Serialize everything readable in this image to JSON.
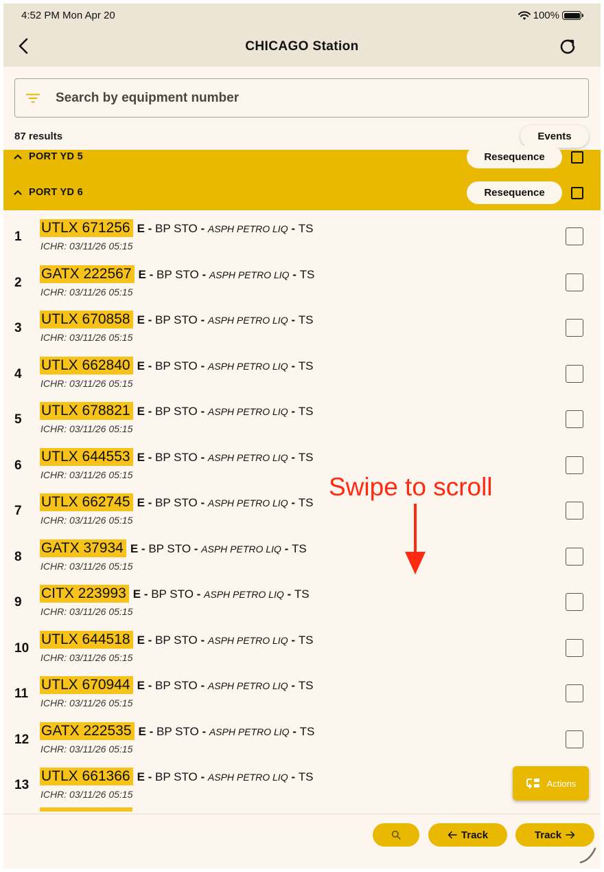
{
  "status_bar": {
    "time": "4:52 PM  Mon Apr 20",
    "battery": "100%"
  },
  "header": {
    "title": "CHICAGO Station",
    "back_icon": "chevron-left-icon",
    "refresh_icon": "refresh-icon"
  },
  "search": {
    "placeholder": "Search by equipment number",
    "value": "",
    "icon": "filter-icon"
  },
  "results": {
    "count_label": "87 results",
    "events_label": "Events"
  },
  "groups": [
    {
      "name": "PORT YD 5",
      "resequence_label": "Resequence"
    },
    {
      "name": "PORT YD 6",
      "resequence_label": "Resequence"
    }
  ],
  "rows": [
    {
      "num": "1",
      "equipment": "UTLX 671256",
      "status": "E",
      "station": "BP STO",
      "commodity": "ASPH PETRO LIQ",
      "code": "TS",
      "ichr": "ICHR: 03/11/26 05:15"
    },
    {
      "num": "2",
      "equipment": "GATX 222567",
      "status": "E",
      "station": "BP STO",
      "commodity": "ASPH PETRO LIQ",
      "code": "TS",
      "ichr": "ICHR: 03/11/26 05:15"
    },
    {
      "num": "3",
      "equipment": "UTLX 670858",
      "status": "E",
      "station": "BP STO",
      "commodity": "ASPH PETRO LIQ",
      "code": "TS",
      "ichr": "ICHR: 03/11/26 05:15"
    },
    {
      "num": "4",
      "equipment": "UTLX 662840",
      "status": "E",
      "station": "BP STO",
      "commodity": "ASPH PETRO LIQ",
      "code": "TS",
      "ichr": "ICHR: 03/11/26 05:15"
    },
    {
      "num": "5",
      "equipment": "UTLX 678821",
      "status": "E",
      "station": "BP STO",
      "commodity": "ASPH PETRO LIQ",
      "code": "TS",
      "ichr": "ICHR: 03/11/26 05:15"
    },
    {
      "num": "6",
      "equipment": "UTLX 644553",
      "status": "E",
      "station": "BP STO",
      "commodity": "ASPH PETRO LIQ",
      "code": "TS",
      "ichr": "ICHR: 03/11/26 05:15"
    },
    {
      "num": "7",
      "equipment": "UTLX 662745",
      "status": "E",
      "station": "BP STO",
      "commodity": "ASPH PETRO LIQ",
      "code": "TS",
      "ichr": "ICHR: 03/11/26 05:15"
    },
    {
      "num": "8",
      "equipment": "GATX 37934",
      "status": "E",
      "station": "BP STO",
      "commodity": "ASPH PETRO LIQ",
      "code": "TS",
      "ichr": "ICHR: 03/11/26 05:15"
    },
    {
      "num": "9",
      "equipment": "CITX 223993",
      "status": "E",
      "station": "BP STO",
      "commodity": "ASPH PETRO LIQ",
      "code": "TS",
      "ichr": "ICHR: 03/11/26 05:15"
    },
    {
      "num": "10",
      "equipment": "UTLX 644518",
      "status": "E",
      "station": "BP STO",
      "commodity": "ASPH PETRO LIQ",
      "code": "TS",
      "ichr": "ICHR: 03/11/26 05:15"
    },
    {
      "num": "11",
      "equipment": "UTLX 670944",
      "status": "E",
      "station": "BP STO",
      "commodity": "ASPH PETRO LIQ",
      "code": "TS",
      "ichr": "ICHR: 03/11/26 05:15"
    },
    {
      "num": "12",
      "equipment": "GATX 222535",
      "status": "E",
      "station": "BP STO",
      "commodity": "ASPH PETRO LIQ",
      "code": "TS",
      "ichr": "ICHR: 03/11/26 05:15"
    },
    {
      "num": "13",
      "equipment": "UTLX 661366",
      "status": "E",
      "station": "BP STO",
      "commodity": "ASPH PETRO LIQ",
      "code": "TS",
      "ichr": "ICHR: 03/11/26 05:15"
    }
  ],
  "overlay": {
    "swipe_text": "Swipe to scroll",
    "arrow_icon": "arrow-down-icon"
  },
  "actions": {
    "label": "Actions",
    "icon": "actions-icon"
  },
  "bottom_bar": {
    "search_icon": "search-icon",
    "track_back_label": "Track",
    "track_forward_label": "Track"
  },
  "colors": {
    "accent": "#e9b800",
    "highlight": "#f7c31a",
    "background": "#fdf6ee",
    "header": "#ece4d4",
    "overlay_text": "#ff2a12"
  }
}
